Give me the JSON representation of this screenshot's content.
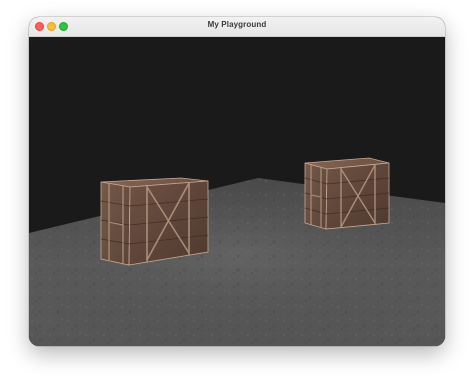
{
  "window": {
    "title": "My Playground",
    "controls": {
      "close_icon": "close-icon",
      "minimize_icon": "minimize-icon",
      "zoom_icon": "zoom-icon"
    }
  },
  "scene": {
    "background_color": "#1a1a1a",
    "floor_color": "#5b5b5b",
    "crate_color": "#6e5140",
    "objects": [
      "wooden-crate",
      "wooden-crate"
    ]
  }
}
